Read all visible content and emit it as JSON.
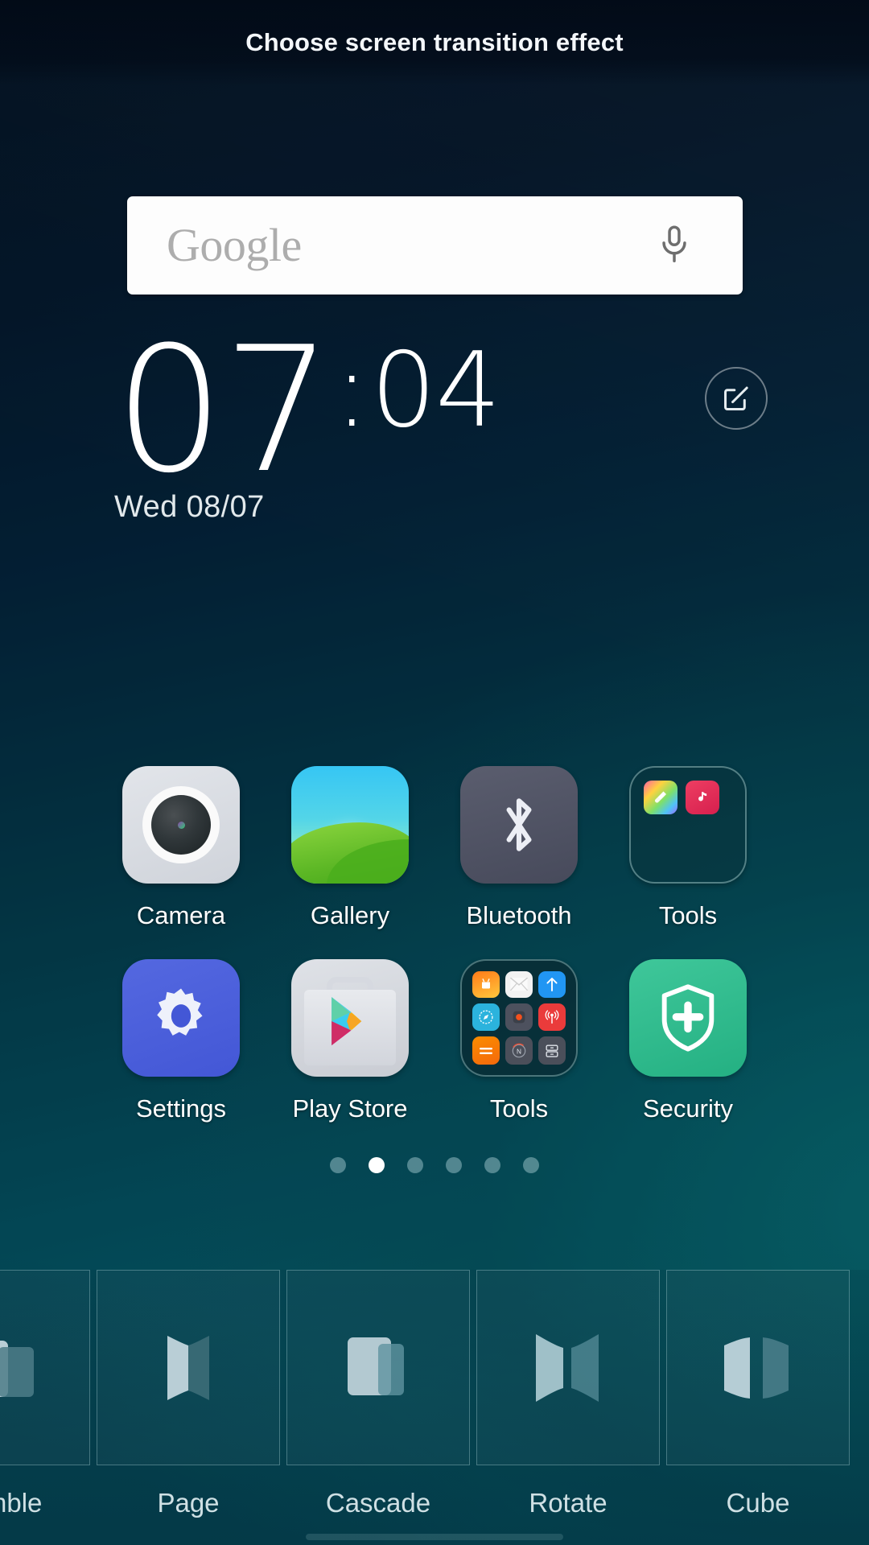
{
  "header": {
    "title": "Choose screen transition effect"
  },
  "search": {
    "logo_text": "Google",
    "mic_icon": "microphone-icon"
  },
  "clock": {
    "hour": "07",
    "colon": ":",
    "minute": "04",
    "date": "Wed 08/07",
    "edit_icon": "edit-square-pencil-icon"
  },
  "apps": {
    "rows": [
      [
        {
          "label": "Camera",
          "icon": "camera-icon"
        },
        {
          "label": "Gallery",
          "icon": "gallery-icon"
        },
        {
          "label": "Bluetooth",
          "icon": "bluetooth-icon"
        },
        {
          "label": "Tools",
          "icon": "folder-icon"
        }
      ],
      [
        {
          "label": "Settings",
          "icon": "settings-gear-icon"
        },
        {
          "label": "Play Store",
          "icon": "play-store-icon"
        },
        {
          "label": "Tools",
          "icon": "folder-icon"
        },
        {
          "label": "Security",
          "icon": "shield-plus-icon"
        }
      ]
    ],
    "folder_mini_icons_1": [
      "paint-brush-icon",
      "music-note-icon"
    ],
    "folder_mini_icons_2": [
      "downloads-robot-icon",
      "email-envelope-icon",
      "upload-arrow-icon",
      "compass-browser-icon",
      "screen-recorder-icon",
      "fm-radio-icon",
      "calculator-icon",
      "compass-north-icon",
      "file-manager-icon"
    ]
  },
  "page_indicator": {
    "total": 6,
    "active_index": 1
  },
  "transitions": {
    "items": [
      {
        "label": "Tumble",
        "preview": "tumble-preview"
      },
      {
        "label": "Page",
        "preview": "page-preview"
      },
      {
        "label": "Cascade",
        "preview": "cascade-preview"
      },
      {
        "label": "Rotate",
        "preview": "rotate-preview"
      },
      {
        "label": "Cube",
        "preview": "cube-preview"
      }
    ]
  },
  "colors": {
    "background_top": "#031222",
    "background_bottom": "#04606c",
    "accent_white": "#ffffff",
    "settings_blue": "#4357d6",
    "security_green": "#24b082",
    "gallery_green": "#5cb725"
  }
}
